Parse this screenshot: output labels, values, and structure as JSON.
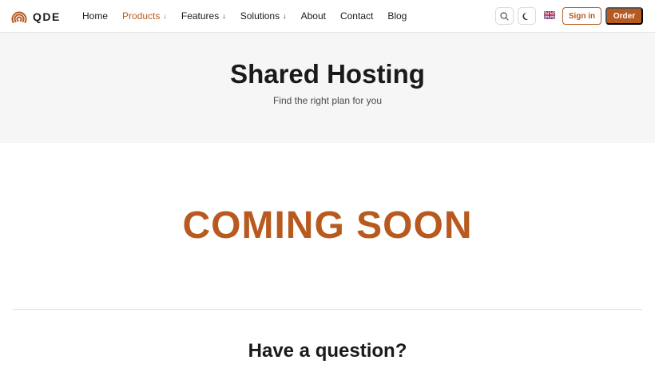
{
  "brand": {
    "name": "QDE",
    "accent_color": "#b85a1f",
    "logo_icon": "concentric-arcs-logo"
  },
  "nav": {
    "items": [
      {
        "label": "Home",
        "has_dropdown": false,
        "active": false
      },
      {
        "label": "Products",
        "has_dropdown": true,
        "active": true
      },
      {
        "label": "Features",
        "has_dropdown": true,
        "active": false
      },
      {
        "label": "Solutions",
        "has_dropdown": true,
        "active": false
      },
      {
        "label": "About",
        "has_dropdown": false,
        "active": false
      },
      {
        "label": "Contact",
        "has_dropdown": false,
        "active": false
      },
      {
        "label": "Blog",
        "has_dropdown": false,
        "active": false
      }
    ],
    "dropdown_arrow": "↓",
    "search_icon": "search-icon",
    "theme_icon": "moon-icon",
    "language_icon": "uk-flag-icon",
    "signin_label": "Sign in",
    "order_label": "Order"
  },
  "hero": {
    "title": "Shared Hosting",
    "subtitle": "Find the right plan for you"
  },
  "main": {
    "coming_soon": "COMING SOON"
  },
  "faq": {
    "title": "Have a question?"
  }
}
